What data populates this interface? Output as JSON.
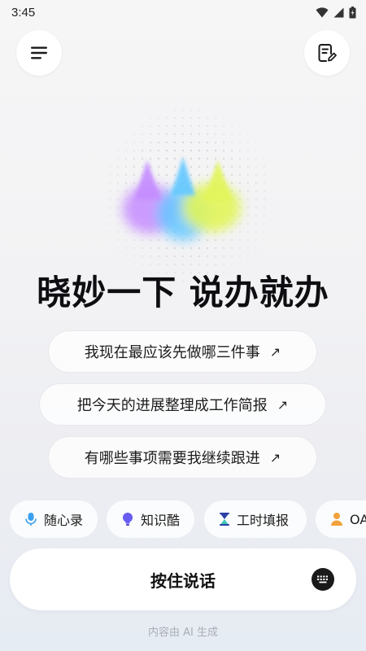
{
  "status_bar": {
    "time": "3:45"
  },
  "header": {
    "menu_icon": "menu-icon",
    "notes_icon": "notes-edit-icon"
  },
  "hero": {
    "headline": "晓妙一下 说办就办",
    "colors": {
      "purple": "#c58cff",
      "blue": "#64c8ff",
      "lime": "#e2f55a"
    }
  },
  "prompts": [
    {
      "text": "我现在最应该先做哪三件事",
      "arrow": "↗"
    },
    {
      "text": "把今天的进展整理成工作简报",
      "arrow": "↗"
    },
    {
      "text": "有哪些事项需要我继续跟进",
      "arrow": "↗"
    }
  ],
  "shortcuts": [
    {
      "label": "随心录",
      "icon": "microphone-icon",
      "color": "#3aa0f0"
    },
    {
      "label": "知识酷",
      "icon": "lightbulb-icon",
      "color": "#6a5cf2"
    },
    {
      "label": "工时填报",
      "icon": "hourglass-icon",
      "color": "#2c3ea8"
    },
    {
      "label": "OA",
      "icon": "person-icon",
      "color": "#f2a23c"
    }
  ],
  "talk": {
    "label": "按住说话",
    "keyboard_icon": "keyboard-icon"
  },
  "footer": {
    "note": "内容由 AI 生成"
  }
}
